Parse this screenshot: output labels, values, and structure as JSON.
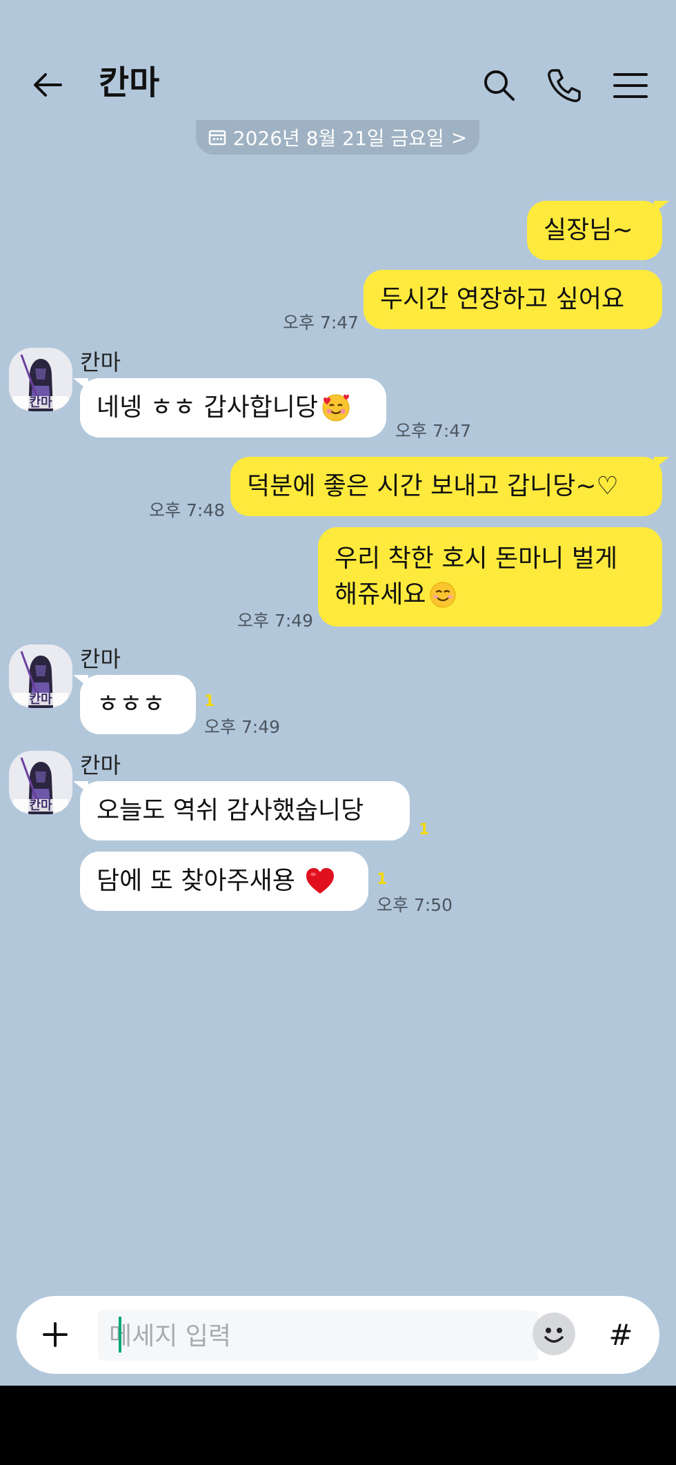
{
  "header": {
    "title": "칸마",
    "icons": [
      "back-arrow-icon",
      "search-icon",
      "phone-icon",
      "menu-icon"
    ]
  },
  "date_divider": {
    "label": "2026년 8월 21일 금요일",
    "chevron": ">"
  },
  "messages": [
    {
      "from": "me",
      "text": "실장님~"
    },
    {
      "from": "me",
      "text": "두시간 연장하고 싶어요",
      "time": "오후 7:47"
    },
    {
      "from": "other",
      "sender": "칸마",
      "text": "네넹 ㅎㅎ 갑사합니당",
      "emoji": "smiling-face-with-hearts",
      "time": "오후 7:47"
    },
    {
      "from": "me",
      "text": "덕분에 좋은 시간 보내고 갑니당~♡",
      "time": "오후 7:48"
    },
    {
      "from": "me",
      "line1": "우리 착한 호시 돈마니 벌게",
      "line2": "해쥬세요",
      "emoji": "smiling-face",
      "time": "오후 7:49"
    },
    {
      "from": "other",
      "sender": "칸마",
      "text": "ㅎㅎㅎ",
      "unread": "1",
      "time": "오후 7:49"
    },
    {
      "from": "other",
      "sender": "칸마",
      "text": "오늘도 역쉬 감사했숩니당",
      "unread": "1"
    },
    {
      "from": "other",
      "text": "담에 또 찾아주새용",
      "emoji": "red-heart",
      "unread": "1",
      "time": "오후 7:50"
    }
  ],
  "input": {
    "placeholder": "메세지 입력",
    "plus_icon": "plus-icon",
    "emoji_icon": "emoji-icon",
    "hash_label": "#"
  },
  "colors": {
    "background": "#b2c7da",
    "my_bubble": "#fee93d",
    "their_bubble": "#ffffff",
    "unread": "#f5d90c"
  }
}
